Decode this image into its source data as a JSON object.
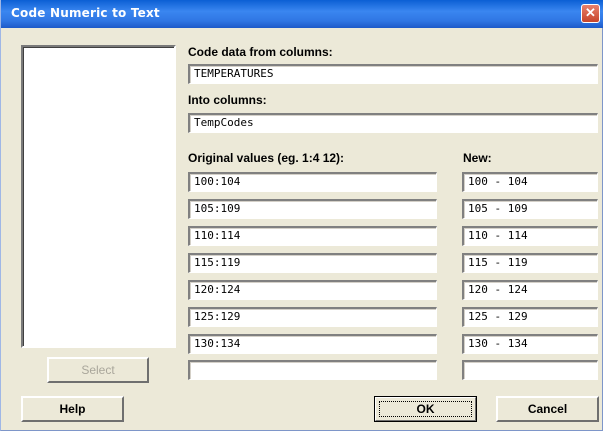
{
  "window": {
    "title": "Code  Numeric to Text",
    "close_glyph": "✕"
  },
  "labels": {
    "code_from": "Code data from columns:",
    "into": "Into columns:",
    "original": "Original values (eg. 1:4  12):",
    "new": "New:"
  },
  "fields": {
    "code_from_value": "TEMPERATURES",
    "into_value": "TempCodes"
  },
  "rows": [
    {
      "original": "100:104",
      "new": "100 - 104"
    },
    {
      "original": "105:109",
      "new": "105 - 109"
    },
    {
      "original": "110:114",
      "new": "110 - 114"
    },
    {
      "original": "115:119",
      "new": "115 - 119"
    },
    {
      "original": "120:124",
      "new": "120 - 124"
    },
    {
      "original": "125:129",
      "new": "125 - 129"
    },
    {
      "original": "130:134",
      "new": "130 - 134"
    },
    {
      "original": "",
      "new": ""
    }
  ],
  "buttons": {
    "select": "Select",
    "help": "Help",
    "ok": "OK",
    "cancel": "Cancel"
  },
  "icons": {
    "close": "close-icon"
  }
}
